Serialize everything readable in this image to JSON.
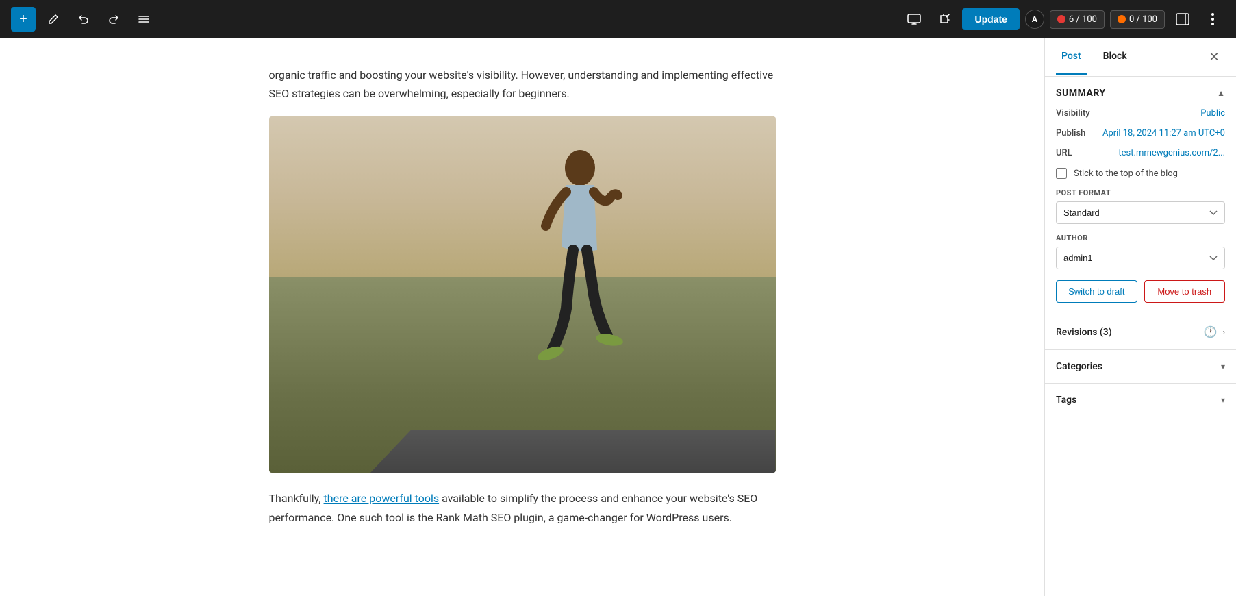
{
  "toolbar": {
    "add_label": "+",
    "update_label": "Update",
    "ahrefs_label": "A",
    "score1": "6 / 100",
    "score2": "0 / 100"
  },
  "editor": {
    "paragraph1": "organic traffic and boosting your website's visibility. However, understanding and implementing effective SEO strategies can be overwhelming, especially for beginners.",
    "paragraph2_start": "Thankfully, ",
    "paragraph2_link": "there are powerful tools",
    "paragraph2_end": " available to simplify the process and enhance your website's SEO performance. One such tool is the Rank Math SEO plugin, a game-changer for WordPress users."
  },
  "sidebar": {
    "tab_post": "Post",
    "tab_block": "Block",
    "summary_title": "Summary",
    "visibility_label": "Visibility",
    "visibility_value": "Public",
    "publish_label": "Publish",
    "publish_value": "April 18, 2024 11:27 am UTC+0",
    "url_label": "URL",
    "url_value": "test.mrnewgenius.com/2...",
    "stick_to_top_label": "Stick to the top of the blog",
    "post_format_label": "POST FORMAT",
    "post_format_value": "Standard",
    "author_label": "AUTHOR",
    "author_value": "admin1",
    "switch_to_draft_label": "Switch to draft",
    "move_to_trash_label": "Move to trash",
    "revisions_label": "Revisions (3)",
    "categories_label": "Categories",
    "tags_label": "Tags"
  }
}
